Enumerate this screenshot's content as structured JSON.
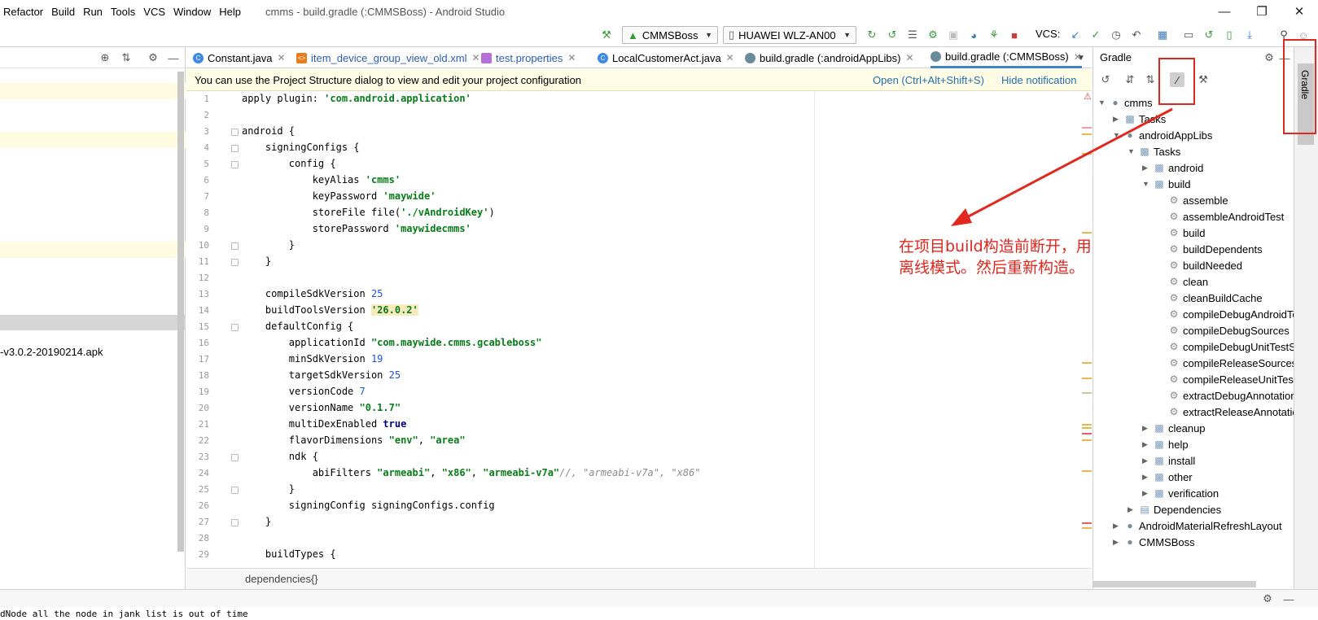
{
  "window": {
    "title": "cmms - build.gradle (:CMMSBoss) - Android Studio",
    "menu": [
      "Refactor",
      "Build",
      "Run",
      "Tools",
      "VCS",
      "Window",
      "Help"
    ]
  },
  "toolbar": {
    "config": "CMMSBoss",
    "device": "HUAWEI WLZ-AN00",
    "vcs_label": "VCS:"
  },
  "left_panel": {
    "apk_text": "-v3.0.2-20190214.apk"
  },
  "tabs": [
    {
      "label": "Constant.java",
      "icon": "class-icon",
      "color": "#3d8ae3"
    },
    {
      "label": "item_device_group_view_old.xml",
      "icon": "xml-icon",
      "color": "#e87d1e"
    },
    {
      "label": "test.properties",
      "icon": "properties-icon",
      "color": "#b66fd6"
    },
    {
      "label": "LocalCustomerAct.java",
      "icon": "class-icon",
      "color": "#3d8ae3"
    },
    {
      "label": "build.gradle (:androidAppLibs)",
      "icon": "gradle-icon",
      "color": "#6b8a9a"
    },
    {
      "label": "build.gradle (:CMMSBoss)",
      "icon": "gradle-icon",
      "color": "#6b8a9a"
    }
  ],
  "notification": {
    "text": "You can use the Project Structure dialog to view and edit your project configuration",
    "open_link": "Open (Ctrl+Alt+Shift+S)",
    "hide_link": "Hide notification"
  },
  "code": {
    "line_numbers": [
      "1",
      "2",
      "3",
      "4",
      "5",
      "6",
      "7",
      "8",
      "9",
      "10",
      "11",
      "12",
      "13",
      "14",
      "15",
      "16",
      "17",
      "18",
      "19",
      "20",
      "21",
      "22",
      "23",
      "24",
      "25",
      "26",
      "27",
      "28",
      "29"
    ],
    "lines": [
      "apply plugin: 'com.android.application'",
      "",
      "android {",
      "    signingConfigs {",
      "        config {",
      "            keyAlias 'cmms'",
      "            keyPassword 'maywide'",
      "            storeFile file('./vAndroidKey')",
      "            storePassword 'maywidecmms'",
      "        }",
      "    }",
      "",
      "    compileSdkVersion 25",
      "    buildToolsVersion '26.0.2'",
      "    defaultConfig {",
      "        applicationId \"com.maywide.cmms.gcableboss\"",
      "        minSdkVersion 19",
      "        targetSdkVersion 25",
      "        versionCode 7",
      "        versionName \"0.1.7\"",
      "        multiDexEnabled true",
      "        flavorDimensions \"env\", \"area\"",
      "        ndk {",
      "            abiFilters \"armeabi\", \"x86\", \"armeabi-v7a\"//, \"armeabi-v7a\", \"x86\"",
      "        }",
      "        signingConfig signingConfigs.config",
      "    }",
      "",
      "    buildTypes {"
    ]
  },
  "breadcrumb": "dependencies{}",
  "gradle_panel": {
    "title": "Gradle",
    "tree": [
      {
        "label": "cmms",
        "depth": 0,
        "toggle": "open",
        "icon": "gradle-elephant-icon"
      },
      {
        "label": "Tasks",
        "depth": 1,
        "toggle": "closed",
        "icon": "folder-gear-icon"
      },
      {
        "label": "androidAppLibs",
        "depth": 1,
        "toggle": "open",
        "icon": "gradle-elephant-icon"
      },
      {
        "label": "Tasks",
        "depth": 2,
        "toggle": "open",
        "icon": "folder-gear-icon"
      },
      {
        "label": "android",
        "depth": 3,
        "toggle": "closed",
        "icon": "folder-gear-icon"
      },
      {
        "label": "build",
        "depth": 3,
        "toggle": "open",
        "icon": "folder-gear-icon"
      },
      {
        "label": "assemble",
        "depth": 4,
        "toggle": "none",
        "icon": "gear-icon"
      },
      {
        "label": "assembleAndroidTest",
        "depth": 4,
        "toggle": "none",
        "icon": "gear-icon"
      },
      {
        "label": "build",
        "depth": 4,
        "toggle": "none",
        "icon": "gear-icon"
      },
      {
        "label": "buildDependents",
        "depth": 4,
        "toggle": "none",
        "icon": "gear-icon"
      },
      {
        "label": "buildNeeded",
        "depth": 4,
        "toggle": "none",
        "icon": "gear-icon"
      },
      {
        "label": "clean",
        "depth": 4,
        "toggle": "none",
        "icon": "gear-icon"
      },
      {
        "label": "cleanBuildCache",
        "depth": 4,
        "toggle": "none",
        "icon": "gear-icon"
      },
      {
        "label": "compileDebugAndroidTe",
        "depth": 4,
        "toggle": "none",
        "icon": "gear-icon"
      },
      {
        "label": "compileDebugSources",
        "depth": 4,
        "toggle": "none",
        "icon": "gear-icon"
      },
      {
        "label": "compileDebugUnitTestSo",
        "depth": 4,
        "toggle": "none",
        "icon": "gear-icon"
      },
      {
        "label": "compileReleaseSources",
        "depth": 4,
        "toggle": "none",
        "icon": "gear-icon"
      },
      {
        "label": "compileReleaseUnitTestS",
        "depth": 4,
        "toggle": "none",
        "icon": "gear-icon"
      },
      {
        "label": "extractDebugAnnotations",
        "depth": 4,
        "toggle": "none",
        "icon": "gear-icon"
      },
      {
        "label": "extractReleaseAnnotatio",
        "depth": 4,
        "toggle": "none",
        "icon": "gear-icon"
      },
      {
        "label": "cleanup",
        "depth": 3,
        "toggle": "closed",
        "icon": "folder-gear-icon"
      },
      {
        "label": "help",
        "depth": 3,
        "toggle": "closed",
        "icon": "folder-gear-icon"
      },
      {
        "label": "install",
        "depth": 3,
        "toggle": "closed",
        "icon": "folder-gear-icon"
      },
      {
        "label": "other",
        "depth": 3,
        "toggle": "closed",
        "icon": "folder-gear-icon"
      },
      {
        "label": "verification",
        "depth": 3,
        "toggle": "closed",
        "icon": "folder-gear-icon"
      },
      {
        "label": "Dependencies",
        "depth": 2,
        "toggle": "closed",
        "icon": "dependencies-icon"
      },
      {
        "label": "AndroidMaterialRefreshLayout",
        "depth": 1,
        "toggle": "closed",
        "icon": "gradle-elephant-icon"
      },
      {
        "label": "CMMSBoss",
        "depth": 1,
        "toggle": "closed",
        "icon": "gradle-elephant-icon"
      }
    ]
  },
  "right_strip": {
    "gradle_tab": "Gradle"
  },
  "annotation": {
    "text": "在项目build构造前断开，用离线模式。然后重新构造。",
    "color": "#e3261c"
  },
  "status": {
    "text": "dNode all the node in jank list is out of time"
  },
  "colors": {
    "accent": "#4083c9",
    "highlight": "#fefbe0",
    "annotation_red": "#e0281e"
  }
}
